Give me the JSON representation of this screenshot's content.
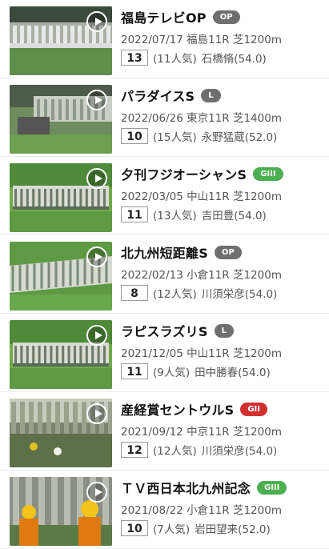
{
  "races": [
    {
      "title": "福島テレビOP",
      "grade": "OP",
      "badge_color": "#6f6f6f",
      "date": "2022/07/17",
      "venue": "福島11R",
      "course": "芝1200m",
      "finish": "13",
      "popularity": "(11人気)",
      "jockey": "石橋脩(54.0)",
      "scene": "gate-stand",
      "play_icon": "play-circle-icon"
    },
    {
      "title": "パラダイスS",
      "grade": "L",
      "badge_color": "#6f6f6f",
      "date": "2022/06/26",
      "venue": "東京11R",
      "course": "芝1400m",
      "finish": "10",
      "popularity": "(15人気)",
      "jockey": "永野猛蔵(52.0)",
      "scene": "gate-truck",
      "play_icon": "play-circle-icon"
    },
    {
      "title": "夕刊フジオーシャンS",
      "grade": "GIII",
      "badge_color": "#4caf50",
      "date": "2022/03/05",
      "venue": "中山11R",
      "course": "芝1200m",
      "finish": "11",
      "popularity": "(13人気)",
      "jockey": "吉田豊(54.0)",
      "scene": "gate-front",
      "play_icon": "play-circle-icon"
    },
    {
      "title": "北九州短距離S",
      "grade": "OP",
      "badge_color": "#6f6f6f",
      "date": "2022/02/13",
      "venue": "小倉11R",
      "course": "芝1200m",
      "finish": "8",
      "popularity": "(12人気)",
      "jockey": "川須栄彦(54.0)",
      "scene": "gate-angle",
      "play_icon": "play-circle-icon"
    },
    {
      "title": "ラピスラズリS",
      "grade": "L",
      "badge_color": "#6f6f6f",
      "date": "2021/12/05",
      "venue": "中山11R",
      "course": "芝1200m",
      "finish": "11",
      "popularity": "(9人気)",
      "jockey": "田中勝春(54.0)",
      "scene": "gate-front",
      "play_icon": "play-circle-icon"
    },
    {
      "title": "産経賞セントウルS",
      "grade": "GII",
      "badge_color": "#d32f2f",
      "date": "2021/09/12",
      "venue": "中京11R",
      "course": "芝1200m",
      "finish": "12",
      "popularity": "(12人気)",
      "jockey": "川須栄彦(54.0)",
      "scene": "gate-rear",
      "play_icon": "play-circle-icon"
    },
    {
      "title": "ＴＶ西日本北九州記念",
      "grade": "GIII",
      "badge_color": "#4caf50",
      "date": "2021/08/22",
      "venue": "小倉11R",
      "course": "芝1200m",
      "finish": "10",
      "popularity": "(7人気)",
      "jockey": "岩田望来(52.0)",
      "scene": "gate-staff",
      "play_icon": "play-circle-icon"
    }
  ]
}
